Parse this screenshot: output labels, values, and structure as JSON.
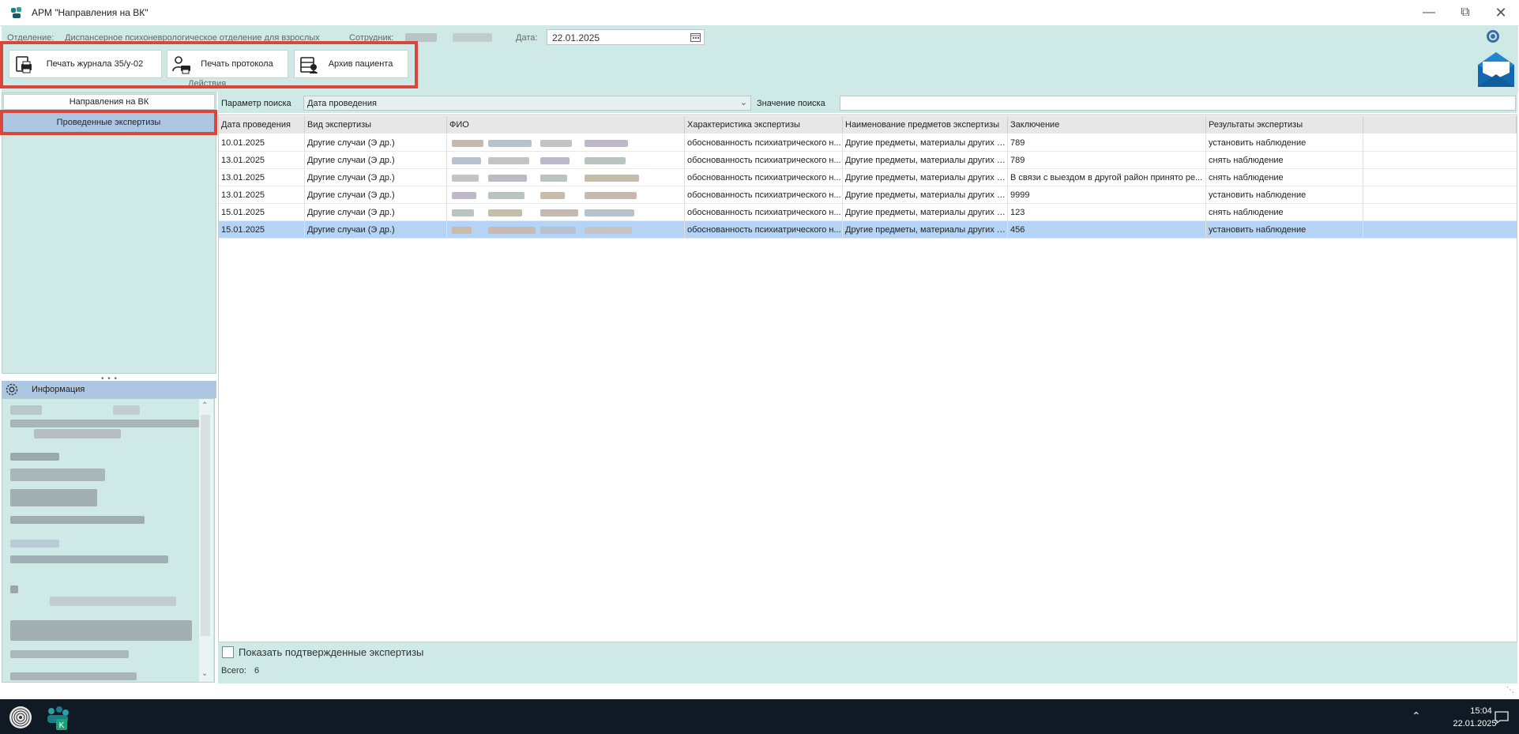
{
  "window": {
    "title": "АРМ \"Направления на ВК\"",
    "controls": [
      "minimize",
      "maximize",
      "close"
    ]
  },
  "header": {
    "department_label": "Отделение:",
    "department_value": "Диспансерное психоневрологическое отделение для взрослых",
    "employee_label": "Сотрудник:",
    "date_label": "Дата:",
    "date_value": "22.01.2025",
    "settings_icon": "gear-icon",
    "mail_icon": "envelope-icon"
  },
  "actions": {
    "caption": "Действия",
    "buttons": [
      {
        "label": "Печать журнала 35/у-02",
        "icon": "print-journal-icon"
      },
      {
        "label": "Печать протокола",
        "icon": "print-protocol-icon"
      },
      {
        "label": "Архив пациента",
        "icon": "patient-archive-icon"
      }
    ]
  },
  "navigation": {
    "items": [
      {
        "label": "Направления на ВК",
        "selected": false
      },
      {
        "label": "Проведенные экспертизы",
        "selected": true
      }
    ]
  },
  "info_panel": {
    "title": "Информация"
  },
  "search": {
    "param_label": "Параметр поиска",
    "param_value": "Дата проведения",
    "value_label": "Значение поиска",
    "value": ""
  },
  "grid": {
    "columns": [
      "Дата проведения",
      "Вид экспертизы",
      "ФИО",
      "Характеристика экспертизы",
      "Наименование предметов экспертизы",
      "Заключение",
      "Результаты экспертизы"
    ],
    "rows": [
      {
        "date": "10.01.2025",
        "type": "Другие случаи (Э др.)",
        "characteristic": "обоснованность психиатрического н...",
        "items": "Другие предметы, материалы других эк...",
        "conclusion": "789",
        "result": "установить наблюдение",
        "selected": false
      },
      {
        "date": "13.01.2025",
        "type": "Другие случаи (Э др.)",
        "characteristic": "обоснованность психиатрического н...",
        "items": "Другие предметы, материалы других эк...",
        "conclusion": "789",
        "result": "снять наблюдение",
        "selected": false
      },
      {
        "date": "13.01.2025",
        "type": "Другие случаи (Э др.)",
        "characteristic": "обоснованность психиатрического н...",
        "items": "Другие предметы, материалы других эк...",
        "conclusion": "В связи с выездом в другой район принято ре...",
        "result": "снять наблюдение",
        "selected": false
      },
      {
        "date": "13.01.2025",
        "type": "Другие случаи (Э др.)",
        "characteristic": "обоснованность психиатрического н...",
        "items": "Другие предметы, материалы других эк...",
        "conclusion": "9999",
        "result": "установить наблюдение",
        "selected": false
      },
      {
        "date": "15.01.2025",
        "type": "Другие случаи (Э др.)",
        "characteristic": "обоснованность психиатрического н...",
        "items": "Другие предметы, материалы других эк...",
        "conclusion": "123",
        "result": "снять наблюдение",
        "selected": false
      },
      {
        "date": "15.01.2025",
        "type": "Другие случаи (Э др.)",
        "characteristic": "обоснованность психиатрического н...",
        "items": "Другие предметы, материалы других эк...",
        "conclusion": "456",
        "result": "установить наблюдение",
        "selected": true
      }
    ]
  },
  "footer": {
    "show_confirmed_label": "Показать подтвержденные экспертизы",
    "show_confirmed_checked": false,
    "total_label": "Всего:",
    "total_value": "6"
  },
  "taskbar": {
    "time": "15:04",
    "date": "22.01.2025"
  },
  "colors": {
    "panel": "#cfe9e6",
    "selection": "#b5d3f4",
    "highlight_frame": "#d9473a",
    "nav_selected": "#adc6e2",
    "taskbar": "#0f1a24"
  }
}
